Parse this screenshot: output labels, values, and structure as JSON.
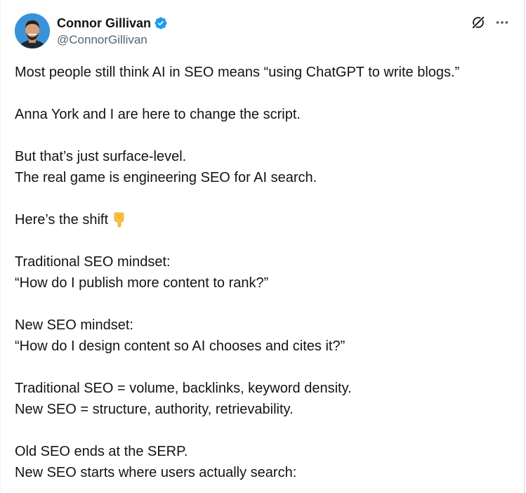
{
  "author": {
    "display_name": "Connor Gillivan",
    "handle": "@ConnorGillivan",
    "verified": true
  },
  "icons": {
    "avatar": "profile-photo",
    "verified_badge": "verified-check-icon",
    "grok": "grok-icon",
    "more": "more-options-icon",
    "emoji": "backhand-index-pointing-down"
  },
  "colors": {
    "verified": "#1d9bf0",
    "secondary_text": "#536471",
    "primary_text": "#0f1419"
  },
  "tweet": {
    "paragraphs": [
      {
        "lines": [
          "Most people still think AI in SEO means “using ChatGPT to write blogs.”"
        ]
      },
      {
        "lines": [
          "Anna York and I are here to change the script."
        ]
      },
      {
        "lines": [
          "But that’s just surface-level.",
          "The real game is engineering SEO for AI search."
        ]
      },
      {
        "lines": [
          "Here’s the shift"
        ]
      },
      {
        "lines": [
          "Traditional SEO mindset:",
          "“How do I publish more content to rank?”"
        ]
      },
      {
        "lines": [
          "New SEO mindset:",
          "“How do I design content so AI chooses and cites it?”"
        ]
      },
      {
        "lines": [
          "Traditional SEO = volume, backlinks, keyword density.",
          "New SEO = structure, authority, retrievability."
        ]
      },
      {
        "lines": [
          "Old SEO ends at the SERP.",
          "New SEO starts where users actually search:"
        ]
      }
    ]
  }
}
